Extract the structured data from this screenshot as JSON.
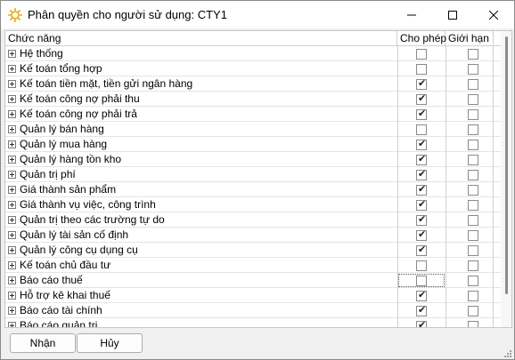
{
  "window": {
    "title": "Phân quyền cho người sử dụng: CTY1",
    "icon": "sun-gear-icon"
  },
  "grid": {
    "columns": {
      "name": "Chức năng",
      "allow": "Cho phép",
      "limit": "Giới hạn"
    },
    "rows": [
      {
        "label": "Hệ thống",
        "allow": false,
        "limit": false
      },
      {
        "label": "Kế toán tổng hợp",
        "allow": false,
        "limit": false
      },
      {
        "label": "Kế toán tiền mặt, tiền gửi ngân hàng",
        "allow": true,
        "limit": false
      },
      {
        "label": "Kế toán công nợ phải thu",
        "allow": true,
        "limit": false
      },
      {
        "label": "Kế toán công nợ phải trả",
        "allow": true,
        "limit": false
      },
      {
        "label": "Quản lý bán hàng",
        "allow": false,
        "limit": false
      },
      {
        "label": "Quản lý mua hàng",
        "allow": true,
        "limit": false
      },
      {
        "label": "Quản lý hàng tồn kho",
        "allow": true,
        "limit": false
      },
      {
        "label": "Quản trị phí",
        "allow": true,
        "limit": false
      },
      {
        "label": "Giá thành sản phẩm",
        "allow": true,
        "limit": false
      },
      {
        "label": "Giá thành vụ việc, công trình",
        "allow": true,
        "limit": false
      },
      {
        "label": "Quản trị theo các trường tự do",
        "allow": true,
        "limit": false
      },
      {
        "label": "Quản lý tài sản cố định",
        "allow": true,
        "limit": false
      },
      {
        "label": "Quản lý công cụ dụng cụ",
        "allow": true,
        "limit": false
      },
      {
        "label": "Kế toán chủ đầu tư",
        "allow": false,
        "limit": false
      },
      {
        "label": "Báo cáo thuế",
        "allow": false,
        "limit": false,
        "focused": true
      },
      {
        "label": "Hỗ trợ kê khai thuế",
        "allow": true,
        "limit": false
      },
      {
        "label": "Báo cáo tài chính",
        "allow": true,
        "limit": false
      },
      {
        "label": "Báo cáo quản trị",
        "allow": true,
        "limit": false
      }
    ]
  },
  "buttons": {
    "ok": "Nhận",
    "cancel": "Hủy"
  }
}
